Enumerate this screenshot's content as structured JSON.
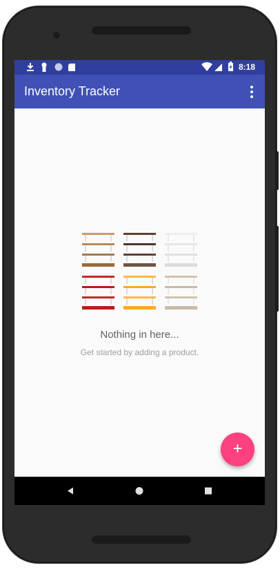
{
  "status_bar": {
    "left_icons": [
      "download-icon",
      "keyhole-icon",
      "circle-icon",
      "sd-card-icon"
    ],
    "right_icons": [
      "wifi-icon",
      "signal-icon",
      "battery-charging-icon"
    ],
    "time": "8:18"
  },
  "app_bar": {
    "title": "Inventory Tracker",
    "menu_icon": "more-vert-icon"
  },
  "empty_state": {
    "illustration": "shelves-illustration",
    "title": "Nothing in here...",
    "subtitle": "Get started by adding a product."
  },
  "fab": {
    "label": "+",
    "color": "#ff4081"
  },
  "nav_bar": {
    "items": [
      "back-icon",
      "home-icon",
      "recents-icon"
    ]
  },
  "colors": {
    "primary": "#3f51b5",
    "primary_dark": "#303f9f",
    "accent": "#ff4081"
  }
}
